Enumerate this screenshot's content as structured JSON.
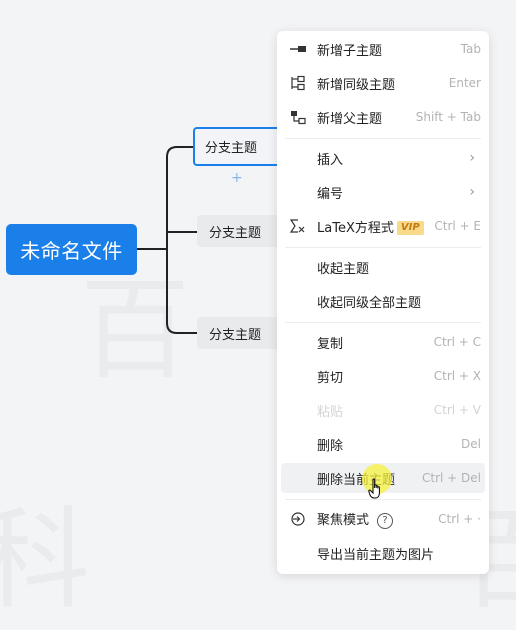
{
  "mindmap": {
    "root_label": "未命名文件",
    "children": [
      {
        "label": "分支主题"
      },
      {
        "label": "分支主题"
      },
      {
        "label": "分支主题"
      }
    ],
    "add_symbol": "+",
    "watermark_chars": [
      "百",
      "科",
      "百"
    ]
  },
  "context_menu": {
    "items": [
      {
        "label": "新增子主题",
        "shortcut": "Tab",
        "icon": "add-child-icon"
      },
      {
        "label": "新增同级主题",
        "shortcut": "Enter",
        "icon": "add-sibling-icon"
      },
      {
        "label": "新增父主题",
        "shortcut": "Shift + Tab",
        "icon": "add-parent-icon"
      },
      {
        "label": "插入",
        "arrow": "›"
      },
      {
        "label": "编号",
        "arrow": "›"
      },
      {
        "label": "LaTeX方程式",
        "badge": "VIP",
        "shortcut": "Ctrl + E",
        "icon": "sigma-icon"
      },
      {
        "label": "收起主题"
      },
      {
        "label": "收起同级全部主题"
      },
      {
        "label": "复制",
        "shortcut": "Ctrl + C"
      },
      {
        "label": "剪切",
        "shortcut": "Ctrl + X"
      },
      {
        "label": "粘贴",
        "shortcut": "Ctrl + V"
      },
      {
        "label": "删除",
        "shortcut": "Del"
      },
      {
        "label": "删除当前主题",
        "shortcut": "Ctrl + Del"
      },
      {
        "label": "聚焦模式",
        "help": "?",
        "shortcut": "Ctrl + ·",
        "icon": "focus-icon"
      },
      {
        "label": "导出当前主题为图片"
      }
    ]
  },
  "colors": {
    "accent": "#1a7fe8",
    "background": "#f3f4f6",
    "node_bg": "#e9eaec",
    "vip_bg": "#f9d98a",
    "vip_text": "#c07a10",
    "cursor_highlight": "#f5f03c"
  }
}
